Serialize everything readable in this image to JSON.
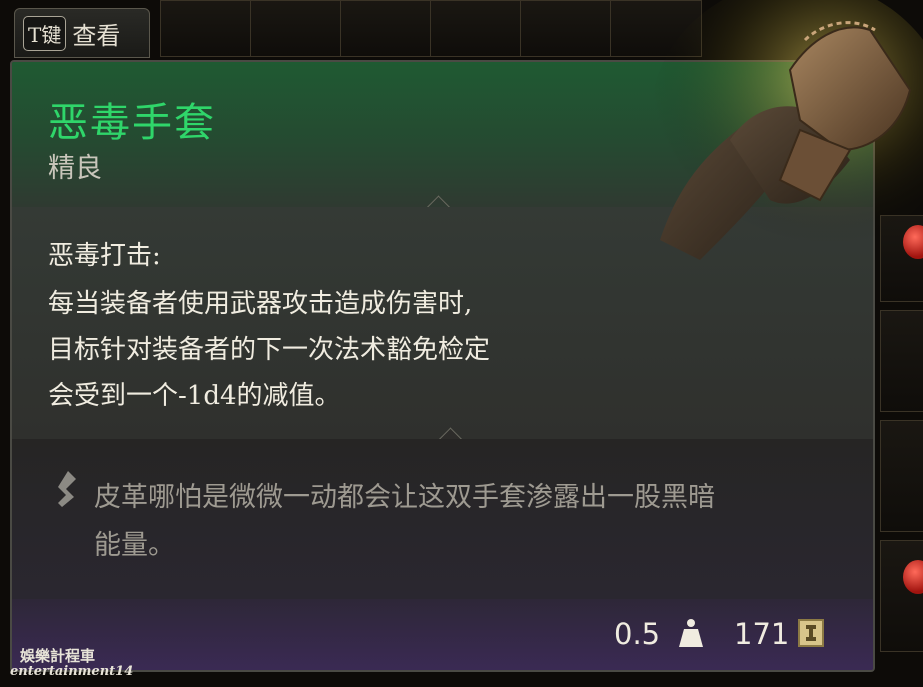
{
  "hint": {
    "key": "T键",
    "label": "查看"
  },
  "item": {
    "name": "恶毒手套",
    "rarity": "精良",
    "name_color": "#2fd66a",
    "rarity_color": "#c9c6bb",
    "icon": "leather-gauntlets-icon"
  },
  "passive": {
    "title": "恶毒打击:",
    "lines": [
      "每当装备者使用武器攻击造成伤害时,",
      "目标针对装备者的下一次法术豁免检定",
      "会受到一个-1d4的减值。"
    ]
  },
  "lore": {
    "icon": "quill-icon",
    "lines": [
      "皮革哪怕是微微一动都会让这双手套渗露出一股黑暗",
      "能量。"
    ]
  },
  "stats": {
    "weight": "0.5",
    "weight_icon": "weight-icon",
    "value": "171",
    "value_icon": "gold-coin-icon"
  },
  "watermark": {
    "logo": "娛樂計程車",
    "text": "entertainment14"
  }
}
